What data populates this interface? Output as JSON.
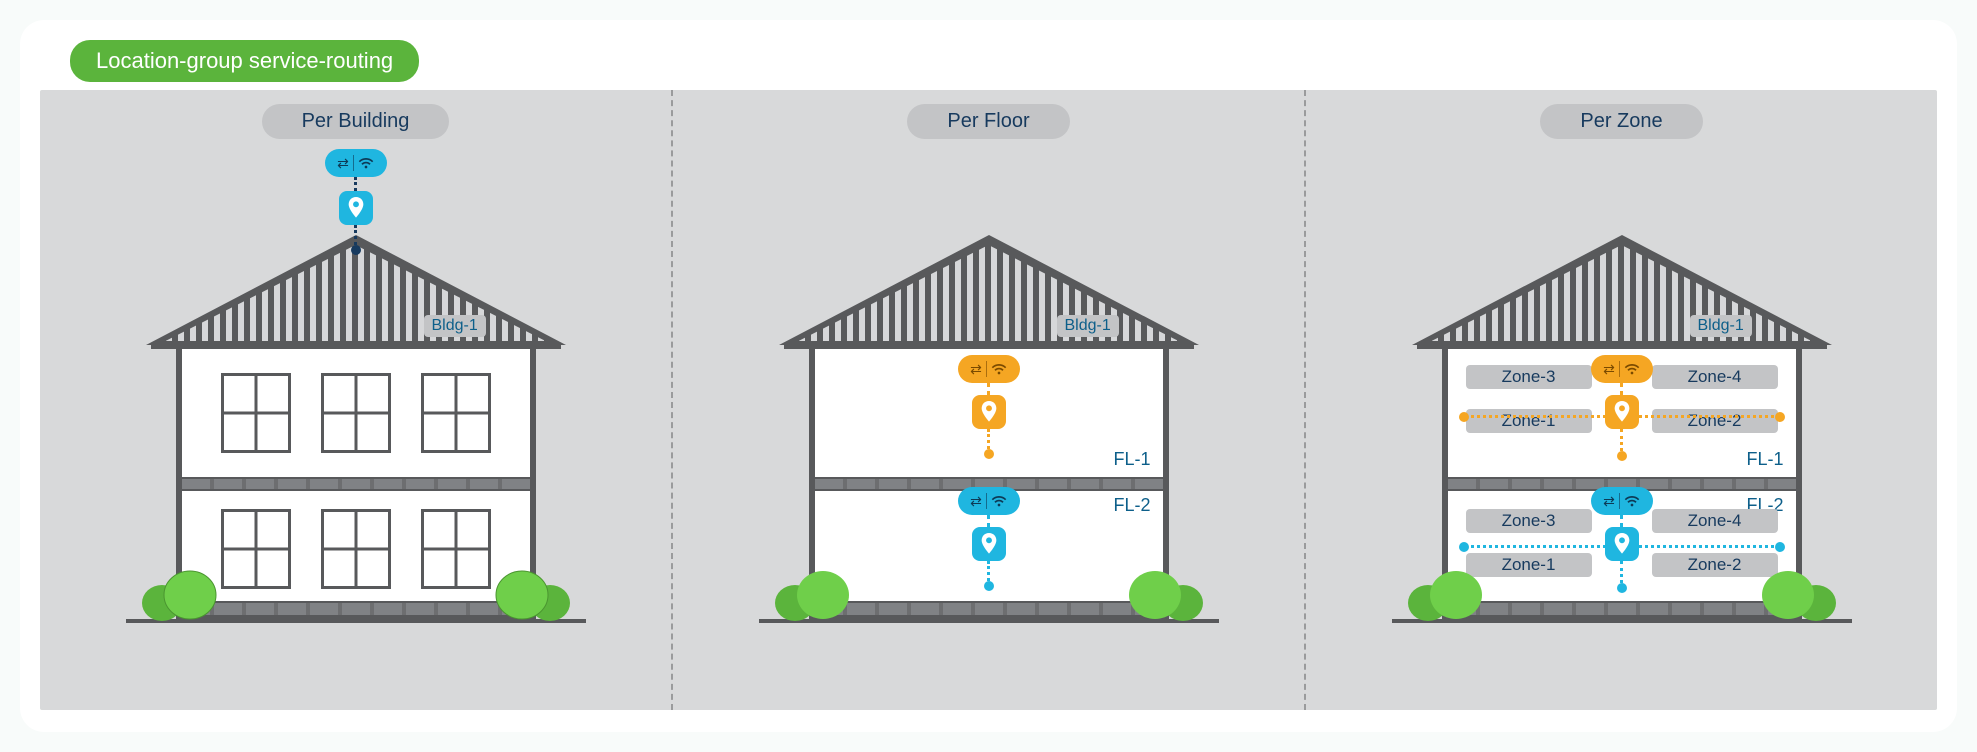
{
  "title": "Location-group service-routing",
  "panels": {
    "building": {
      "title": "Per Building",
      "bldg": "Bldg-1"
    },
    "floor": {
      "title": "Per Floor",
      "bldg": "Bldg-1",
      "fl1": "FL-1",
      "fl2": "FL-2"
    },
    "zone": {
      "title": "Per Zone",
      "bldg": "Bldg-1",
      "fl1": "FL-1",
      "fl2": "FL-2",
      "z1": "Zone-1",
      "z2": "Zone-2",
      "z3": "Zone-3",
      "z4": "Zone-4"
    }
  },
  "colors": {
    "accent_green": "#5bb43c",
    "blue": "#1fb6e0",
    "orange": "#f5a623"
  }
}
